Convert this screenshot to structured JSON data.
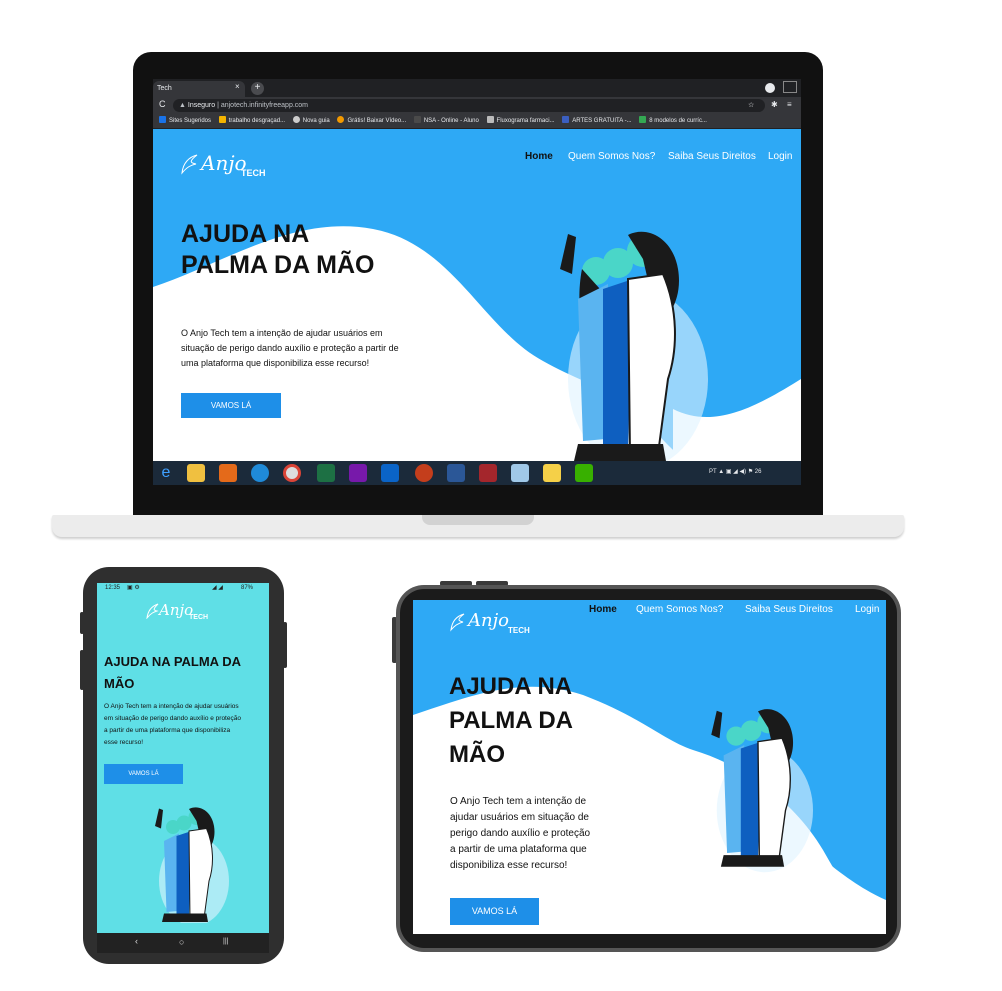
{
  "site": {
    "logo_script": "Anjo",
    "logo_tech": "TECH",
    "nav": [
      {
        "label": "Home"
      },
      {
        "label": "Quem Somos Nos?"
      },
      {
        "label": "Saiba Seus Direitos"
      },
      {
        "label": "Login"
      }
    ],
    "hero_title_laptop_1": "AJUDA NA",
    "hero_title_laptop_2": "PALMA DA MÃO",
    "hero_title_tablet_1": "AJUDA NA",
    "hero_title_tablet_2": "PALMA DA",
    "hero_title_tablet_3": "MÃO",
    "hero_title_phone_1": "AJUDA NA PALMA DA",
    "hero_title_phone_2": "MÃO",
    "hero_text_laptop": [
      "O Anjo Tech tem a intenção de ajudar usuários em",
      "situação de perigo dando auxílio e proteção a partir de",
      "uma plataforma que disponibiliza esse recurso!"
    ],
    "hero_text_tablet": [
      "O Anjo Tech tem a intenção de",
      "ajudar usuários em situação de",
      "perigo dando auxílio e proteção",
      "a partir de uma plataforma que",
      "disponibiliza esse recurso!"
    ],
    "hero_text_phone": [
      "O Anjo Tech tem a intenção de ajudar usuários",
      "em situação de perigo dando auxílio e proteção",
      "a partir de uma plataforma que disponibiliza",
      "esse recurso!"
    ],
    "cta_label": "VAMOS LÁ"
  },
  "browser": {
    "tab_title": "Tech",
    "tab_close": "×",
    "new_tab": "+",
    "insecure_label": "Inseguro",
    "url": "anjotech.infinityfreeapp.com",
    "star_icon": "☆",
    "bookmarks": [
      {
        "label": "Sites Sugeridos",
        "color": "#1a73e8"
      },
      {
        "label": "trabalho desgraçad...",
        "color": "#f4b400"
      },
      {
        "label": "Nova guia",
        "color": "#cccccc"
      },
      {
        "label": "Grátis! Baixar Vídeo...",
        "color": "#f29900"
      },
      {
        "label": "NSA - Online - Aluno",
        "color": "#4a4a4a"
      },
      {
        "label": "Fluxograma farmaci...",
        "color": "#bbbbbb"
      },
      {
        "label": "ARTES GRATUITA -...",
        "color": "#3b5fc0"
      },
      {
        "label": "8 modelos de curríc...",
        "color": "#34a853"
      }
    ]
  },
  "taskbar": {
    "tray_lang": "PT",
    "tray_time": "26"
  },
  "phone": {
    "time": "12:35",
    "battery": "87%",
    "nav_back": "‹",
    "nav_home": "○",
    "nav_recent": "|||"
  },
  "colors": {
    "brand_blue": "#2ea9f5",
    "cta_blue": "#1e8fe8",
    "phone_bg": "#5fdfe6"
  }
}
